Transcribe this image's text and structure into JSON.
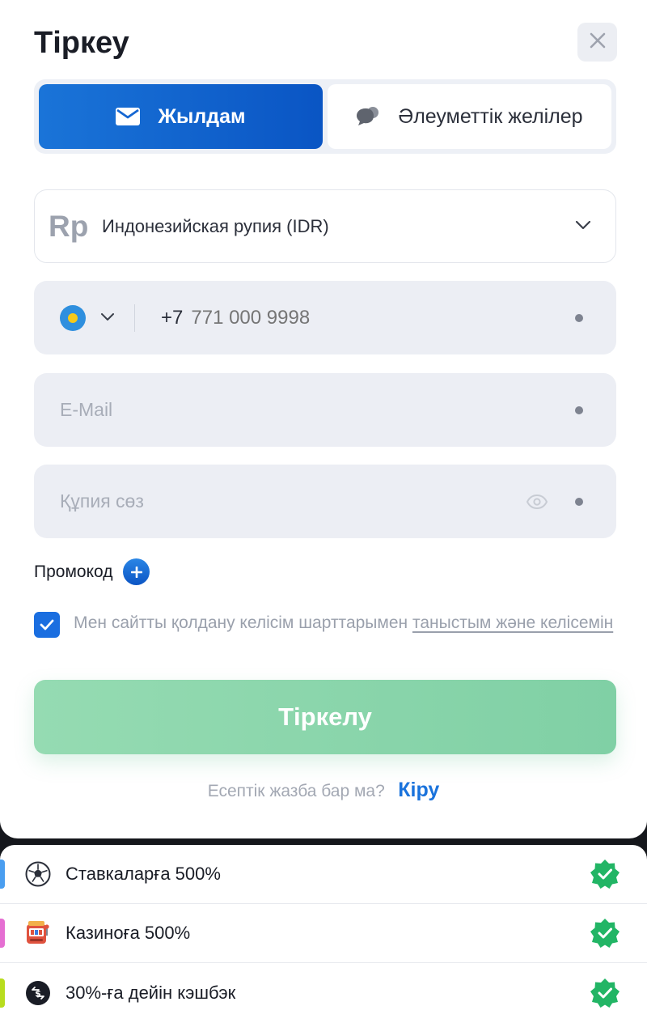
{
  "modal": {
    "title": "Тіркеу",
    "close_icon": "close-icon"
  },
  "tabs": [
    {
      "label": "Жылдам",
      "icon": "envelope-icon",
      "active": true
    },
    {
      "label": "Әлеуметтік желілер",
      "icon": "chat-bubbles-icon",
      "active": false
    }
  ],
  "currency": {
    "symbol": "Rp",
    "label": "Индонезийская рупия (IDR)"
  },
  "phone": {
    "country_code": "+7",
    "placeholder": "771 000 9998",
    "flag": "kazakhstan-flag-icon"
  },
  "email": {
    "placeholder": "E-Mail"
  },
  "password": {
    "placeholder": "Құпия сөз"
  },
  "promo": {
    "label": "Промокод"
  },
  "agreement": {
    "text": "Мен сайтты қолдану келісім шарттарымен ",
    "link": "таныстым және келісемін",
    "checked": true
  },
  "submit": {
    "label": "Тіркелу"
  },
  "login": {
    "question": "Есептік жазба бар ма?",
    "link": "Кіру"
  },
  "bonuses": [
    {
      "label": "Ставкаларға 500%",
      "icon": "soccer-ball-icon",
      "bar_color": "#4a9ef0"
    },
    {
      "label": "Казиноға 500%",
      "icon": "slot-machine-icon",
      "bar_color": "#e56fd2"
    },
    {
      "label": "30%-ға дейін кэшбэк",
      "icon": "cashback-coin-icon",
      "bar_color": "#b8dd1e"
    }
  ],
  "colors": {
    "primary": "#1a6ee0",
    "submit_green": "#8ad6ab",
    "check_green": "#22b565",
    "field_bg": "#eceef4"
  }
}
